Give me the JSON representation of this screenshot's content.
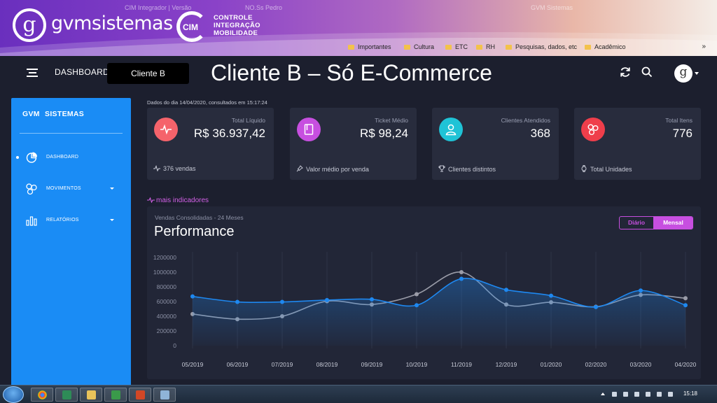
{
  "banner": {
    "brand_text": "gvmsistemas",
    "brand_glyph": "g",
    "cim_badge": "CIM",
    "cim_lines": [
      "CONTROLE",
      "INTEGRAÇÃO",
      "MOBILIDADE"
    ],
    "browser_tabs": [
      "CIM Integrador | Versão",
      "NO.Ss Pedro",
      "GVM Sistemas"
    ],
    "bookmarks": [
      "Importantes",
      "Cultura",
      "ETC",
      "RH",
      "Pesquisas, dados, etc",
      "Acadêmico"
    ],
    "bookmarks_more": "»",
    "colors": {
      "start": "#6a2fbe",
      "end": "#f4ede7"
    }
  },
  "header": {
    "section": "DASHBOARD",
    "client_selector": "Cliente B",
    "page_title": "Cliente B – Só E-Commerce",
    "icons": [
      "refresh-icon",
      "search-icon",
      "user-avatar"
    ],
    "avatar_glyph": "g"
  },
  "sidebar": {
    "brand": "GVM SISTEMAS",
    "accent": "#1a8cf5",
    "items": [
      {
        "label": "DASHBOARD",
        "icon": "pie-chart-icon",
        "active": true
      },
      {
        "label": "MOVIMENTOS",
        "icon": "molecule-icon",
        "has_caret": true
      },
      {
        "label": "RELATÓRIOS",
        "icon": "bar-chart-icon",
        "has_caret": true
      }
    ]
  },
  "main": {
    "date_line": "Dados do dia 14/04/2020, consultados em 15:17:24",
    "cards": [
      {
        "title": "Total Líquido",
        "value": "R$ 36.937,42",
        "footer": "376 vendas",
        "icon": "activity-icon",
        "color": "#f5636b"
      },
      {
        "title": "Ticket Médio",
        "value": "R$ 98,24",
        "footer": "Valor médio por venda",
        "icon": "book-icon",
        "color": "#c74fe0"
      },
      {
        "title": "Clientes Atendidos",
        "value": "368",
        "footer": "Clientes distintos",
        "icon": "user-icon",
        "color": "#1fc3d6"
      },
      {
        "title": "Total Itens",
        "value": "776",
        "footer": "Total Unidades",
        "icon": "molecule-icon",
        "color": "#ef3e4b"
      }
    ],
    "more_indicators": "mais indicadores",
    "performance": {
      "subtitle": "Vendas Consolidadas - 24 Meses",
      "title": "Performance",
      "toggle": [
        "Diário",
        "Mensal"
      ],
      "toggle_selected": "Mensal"
    }
  },
  "chart_data": {
    "type": "area",
    "title": "Performance",
    "categories": [
      "05/2019",
      "06/2019",
      "07/2019",
      "08/2019",
      "09/2019",
      "10/2019",
      "11/2019",
      "12/2019",
      "01/2020",
      "02/2020",
      "03/2020",
      "04/2020"
    ],
    "series": [
      {
        "color": "#1e88f0",
        "values": [
          670000,
          595000,
          595000,
          620000,
          630000,
          550000,
          910000,
          760000,
          680000,
          525000,
          750000,
          550000
        ]
      },
      {
        "color": "#9a9ca8",
        "values": [
          430000,
          360000,
          400000,
          605000,
          560000,
          700000,
          1000000,
          560000,
          590000,
          530000,
          690000,
          645000
        ]
      }
    ],
    "y_ticks": [
      "1200000",
      "1000000",
      "800000",
      "600000",
      "400000",
      "200000",
      "0"
    ],
    "ylim": [
      0,
      1200000
    ],
    "grid": "vertical"
  },
  "taskbar": {
    "clock": "15:18",
    "apps": [
      "chrome-icon",
      "explorer-icon",
      "folder-icon",
      "app-icon",
      "powerpoint-icon",
      "window-icon"
    ]
  }
}
